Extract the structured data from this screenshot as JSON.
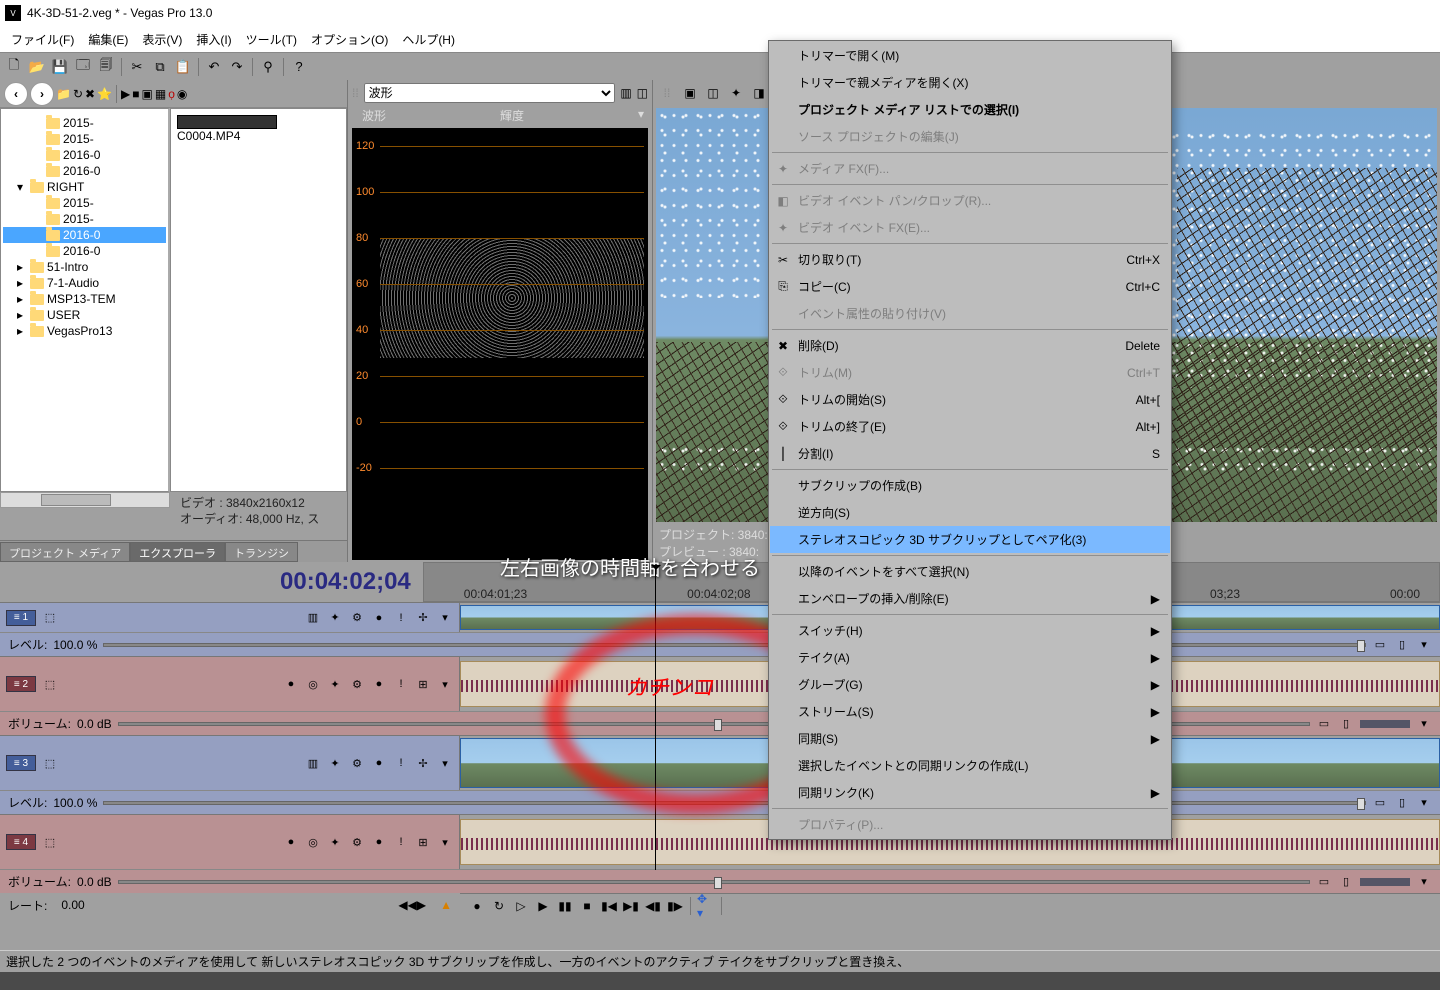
{
  "title": "4K-3D-51-2.veg * - Vegas Pro 13.0",
  "menu": {
    "file": "ファイル(F)",
    "edit": "編集(E)",
    "view": "表示(V)",
    "insert": "挿入(I)",
    "tool": "ツール(T)",
    "option": "オプション(O)",
    "help": "ヘルプ(H)"
  },
  "explorer": {
    "media_file": "C0004.MP4",
    "tree": [
      {
        "l": 2,
        "t": "2015-"
      },
      {
        "l": 2,
        "t": "2015-"
      },
      {
        "l": 2,
        "t": "2016-0"
      },
      {
        "l": 2,
        "t": "2016-0"
      },
      {
        "l": 1,
        "t": "RIGHT",
        "open": true
      },
      {
        "l": 2,
        "t": "2015-"
      },
      {
        "l": 2,
        "t": "2015-"
      },
      {
        "l": 2,
        "t": "2016-0",
        "sel": true
      },
      {
        "l": 2,
        "t": "2016-0"
      },
      {
        "l": 1,
        "t": "51-Intro"
      },
      {
        "l": 1,
        "t": "7-1-Audio"
      },
      {
        "l": 1,
        "t": "MSP13-TEM"
      },
      {
        "l": 1,
        "t": "USER"
      },
      {
        "l": 1,
        "t": "VegasPro13"
      }
    ],
    "tabs": {
      "pm": "プロジェクト メディア",
      "ex": "エクスプローラ",
      "tr": "トランジシ"
    },
    "video_info": "ビデオ :   3840x2160x12",
    "audio_info": "オーディオ: 48,000 Hz, ス"
  },
  "scope": {
    "mode": "波形",
    "h1": "波形",
    "h2": "輝度",
    "y": [
      "120",
      "100",
      "80",
      "60",
      "40",
      "20",
      "0",
      "-20"
    ]
  },
  "preview": {
    "l1": "プロジェクト: 3840:",
    "l2": "プレビュー   : 3840:"
  },
  "timeline": {
    "time": "00:04:02;04",
    "ruler": [
      "00:04:01;23",
      "00:04:02;08"
    ],
    "ruler2": "03;23",
    "ruler3": "00:00",
    "level_lbl": "レベル:",
    "vol_lbl": "ボリューム:",
    "level_val": "100.0 %",
    "vol_val": "0.0 dB",
    "rate_lbl": "レート:",
    "rate_val": "0.00"
  },
  "annot": {
    "sync": "左右画像の時間軸を合わせる",
    "kachi": "カチンコ"
  },
  "status": "選択した 2 つのイベントのメディアを使用して 新しいステレオスコピック 3D サブクリップを作成し、一方のイベントのアクティブ テイクをサブクリップと置き換え、",
  "ctx": [
    {
      "t": "トリマーで開く(M)"
    },
    {
      "t": "トリマーで親メディアを開く(X)"
    },
    {
      "t": "プロジェクト メディア リストでの選択(I)",
      "bold": true
    },
    {
      "t": "ソース プロジェクトの編集(J)",
      "dis": true
    },
    {
      "sep": true
    },
    {
      "t": "メディア FX(F)...",
      "dis": true,
      "ico": "✦"
    },
    {
      "sep": true
    },
    {
      "t": "ビデオ イベント パン/クロップ(R)...",
      "dis": true,
      "ico": "◧"
    },
    {
      "t": "ビデオ イベント FX(E)...",
      "dis": true,
      "ico": "✦"
    },
    {
      "sep": true
    },
    {
      "t": "切り取り(T)",
      "sc": "Ctrl+X",
      "ico": "✂"
    },
    {
      "t": "コピー(C)",
      "sc": "Ctrl+C",
      "ico": "⎘"
    },
    {
      "t": "イベント属性の貼り付け(V)",
      "dis": true
    },
    {
      "sep": true
    },
    {
      "t": "削除(D)",
      "sc": "Delete",
      "ico": "✖"
    },
    {
      "t": "トリム(M)",
      "sc": "Ctrl+T",
      "dis": true,
      "ico": "⟐"
    },
    {
      "t": "トリムの開始(S)",
      "sc": "Alt+[",
      "ico": "⟐"
    },
    {
      "t": "トリムの終了(E)",
      "sc": "Alt+]",
      "ico": "⟐"
    },
    {
      "t": "分割(I)",
      "sc": "S",
      "ico": "⎮"
    },
    {
      "sep": true
    },
    {
      "t": "サブクリップの作成(B)"
    },
    {
      "t": "逆方向(S)"
    },
    {
      "t": "ステレオスコピック 3D サブクリップとしてペア化(3)",
      "hl": true
    },
    {
      "sep": true
    },
    {
      "t": "以降のイベントをすべて選択(N)"
    },
    {
      "t": "エンベロープの挿入/削除(E)",
      "sub": true
    },
    {
      "sep": true
    },
    {
      "t": "スイッチ(H)",
      "sub": true
    },
    {
      "t": "テイク(A)",
      "sub": true
    },
    {
      "t": "グループ(G)",
      "sub": true
    },
    {
      "t": "ストリーム(S)",
      "sub": true
    },
    {
      "t": "同期(S)",
      "sub": true
    },
    {
      "t": "選択したイベントとの同期リンクの作成(L)"
    },
    {
      "t": "同期リンク(K)",
      "sub": true
    },
    {
      "sep": true
    },
    {
      "t": "プロパティ(P)...",
      "dis": true
    }
  ]
}
